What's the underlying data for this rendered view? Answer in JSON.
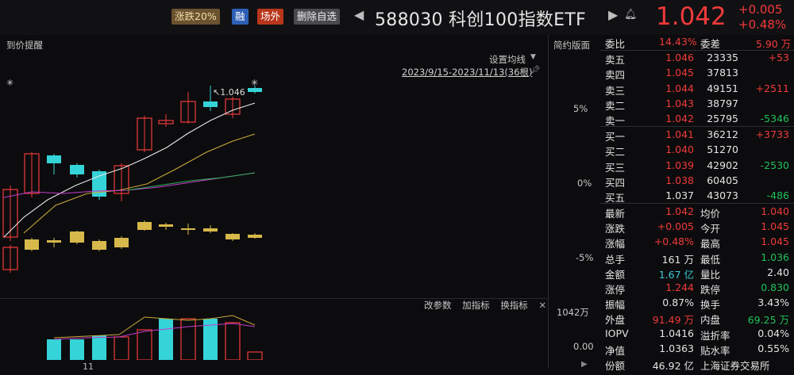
{
  "header": {
    "tags": {
      "limit": "涨跌20%",
      "margin": "融",
      "off_market": "场外",
      "remove_watch": "删除自选"
    },
    "title": "588030 科创100指数ETF",
    "price": "1.042",
    "change_abs": "+0.005",
    "change_pct": "+0.48%"
  },
  "chart": {
    "price_alert": "到价提醒",
    "simple_layout": "简约版面",
    "ma_settings": "设置均线",
    "date_range": "2023/9/15-2023/11/13(36根)",
    "high_marker": "1.046",
    "y_labels": [
      "5%",
      "0%",
      "-5%"
    ],
    "volume_controls": [
      "改参数",
      "加指标",
      "换指标"
    ],
    "volume_max": "1042万",
    "volume_zero": "0.00",
    "x_tick": "11",
    "colors": {
      "up": "#f23a3a",
      "down": "#35d4d8",
      "flat": "#d7b84a",
      "ma5": "#e8e8e8",
      "ma10": "#c9a83a",
      "ma20": "#c23ec9",
      "ma30": "#2fae5a"
    }
  },
  "order_book": {
    "weibi_label": "委比",
    "weibi_value": "14.43%",
    "weicha_label": "委差",
    "weicha_value": "5.90 万",
    "asks": [
      {
        "label": "卖五",
        "price": "1.046",
        "vol": "23335",
        "chg": "+53"
      },
      {
        "label": "卖四",
        "price": "1.045",
        "vol": "37813",
        "chg": ""
      },
      {
        "label": "卖三",
        "price": "1.044",
        "vol": "49151",
        "chg": "+2511"
      },
      {
        "label": "卖二",
        "price": "1.043",
        "vol": "38797",
        "chg": ""
      },
      {
        "label": "卖一",
        "price": "1.042",
        "vol": "25795",
        "chg": "-5346"
      }
    ],
    "bids": [
      {
        "label": "买一",
        "price": "1.041",
        "vol": "36212",
        "chg": "+3733"
      },
      {
        "label": "买二",
        "price": "1.040",
        "vol": "51270",
        "chg": ""
      },
      {
        "label": "买三",
        "price": "1.039",
        "vol": "42902",
        "chg": "-2530"
      },
      {
        "label": "买四",
        "price": "1.038",
        "vol": "60405",
        "chg": ""
      },
      {
        "label": "买五",
        "price": "1.037",
        "vol": "43073",
        "chg": "-486"
      }
    ]
  },
  "stats": [
    {
      "l1": "最新",
      "v1": "1.042",
      "l2": "均价",
      "v2": "1.040"
    },
    {
      "l1": "涨跌",
      "v1": "+0.005",
      "l2": "今开",
      "v2": "1.045"
    },
    {
      "l1": "涨幅",
      "v1": "+0.48%",
      "l2": "最高",
      "v2": "1.045"
    },
    {
      "l1": "总手",
      "v1": "161 万",
      "l2": "最低",
      "v2": "1.036"
    },
    {
      "l1": "金额",
      "v1": "1.67 亿",
      "l2": "量比",
      "v2": "2.40"
    },
    {
      "l1": "涨停",
      "v1": "1.244",
      "l2": "跌停",
      "v2": "0.830"
    },
    {
      "l1": "振幅",
      "v1": "0.87%",
      "l2": "换手",
      "v2": "3.43%"
    },
    {
      "l1": "外盘",
      "v1": "91.49 万",
      "l2": "内盘",
      "v2": "69.25 万"
    },
    {
      "l1": "IOPV",
      "v1": "1.0416",
      "l2": "溢折率",
      "v2": "0.04%"
    },
    {
      "l1": "净值",
      "v1": "1.0363",
      "l2": "贴水率",
      "v2": "0.55%"
    },
    {
      "l1": "份额",
      "v1": "46.92 亿",
      "l2": "上海证券交易所",
      "v2": ""
    }
  ]
}
